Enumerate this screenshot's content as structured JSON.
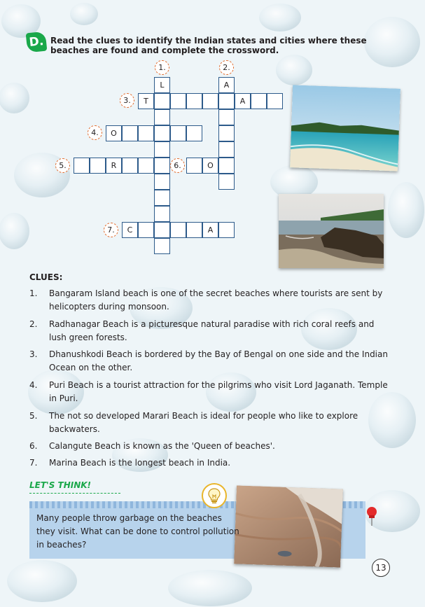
{
  "section": {
    "badge": "D.",
    "instruction": "Read the clues to identify the Indian states and cities where these beaches are found and complete the crossword."
  },
  "crossword": {
    "numbers": [
      "1.",
      "2.",
      "3.",
      "4.",
      "5.",
      "6.",
      "7."
    ],
    "letters": {
      "l": "L",
      "a2": "A",
      "t": "T",
      "a3": "A",
      "o4": "O",
      "r5": "R",
      "o6": "O",
      "c7": "C",
      "a7": "A"
    }
  },
  "clues": {
    "heading": "CLUES:",
    "items": [
      {
        "n": "1.",
        "text": "Bangaram Island beach is one of the secret beaches where tourists are sent by helicopters during monsoon."
      },
      {
        "n": "2.",
        "text": "Radhanagar Beach is a picturesque natural paradise with rich coral reefs and lush green forests."
      },
      {
        "n": "3.",
        "text": "Dhanushkodi Beach is bordered by the Bay of Bengal on one side and the Indian Ocean on the other."
      },
      {
        "n": "4.",
        "text": "Puri Beach is a tourist attraction for the pilgrims who visit Lord Jaganath. Temple in Puri."
      },
      {
        "n": "5.",
        "text": "The not so developed Marari Beach is ideal for people who like to explore backwaters."
      },
      {
        "n": "6.",
        "text": "Calangute Beach is known as the 'Queen of beaches'."
      },
      {
        "n": "7.",
        "text": "Marina Beach is the longest beach in India."
      }
    ]
  },
  "lets_think": {
    "title": "LET'S THINK!",
    "text": "Many people throw garbage on the beaches they visit. What can be done to control pollution in beaches?"
  },
  "page_number": "13",
  "icons": [
    "lightbulb-icon",
    "pushpin-icon"
  ],
  "colors": {
    "accent_green": "#1aa84a",
    "grid_blue": "#2c5a8a",
    "number_orange": "#e06a2c",
    "box_blue": "#b7d3ec"
  }
}
